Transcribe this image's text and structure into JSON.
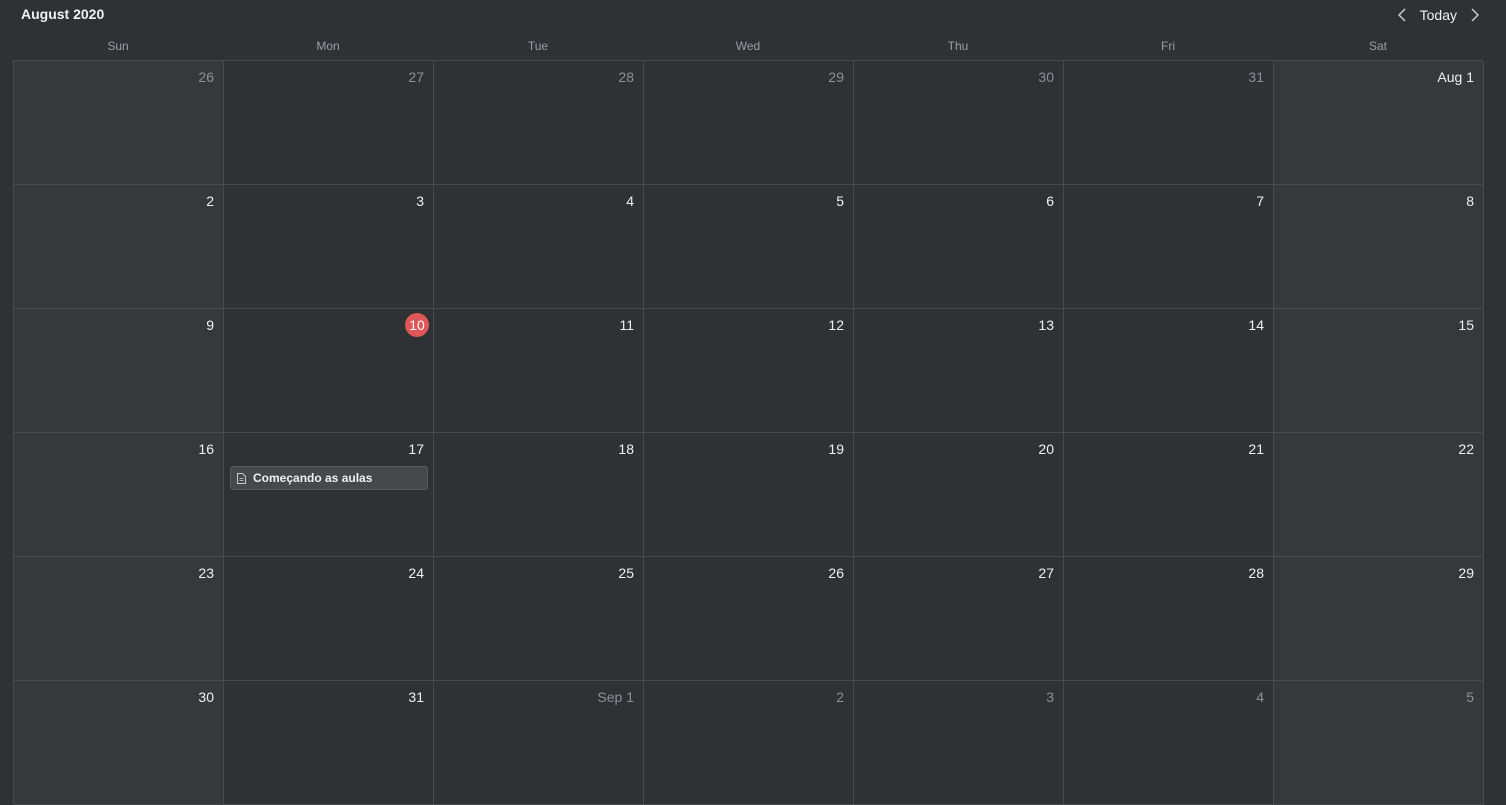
{
  "header": {
    "title": "August 2020",
    "today_label": "Today",
    "prev_icon": "chevron-left-icon",
    "next_icon": "chevron-right-icon"
  },
  "weekdays": [
    "Sun",
    "Mon",
    "Tue",
    "Wed",
    "Thu",
    "Fri",
    "Sat"
  ],
  "colors": {
    "background": "#2e3235",
    "weekend_background": "#36393c",
    "grid_line": "#474b4e",
    "today_badge": "#e05656",
    "event_background": "#45494c"
  },
  "weeks": [
    [
      {
        "label": "26",
        "current_month": false
      },
      {
        "label": "27",
        "current_month": false
      },
      {
        "label": "28",
        "current_month": false
      },
      {
        "label": "29",
        "current_month": false
      },
      {
        "label": "30",
        "current_month": false
      },
      {
        "label": "31",
        "current_month": false
      },
      {
        "label": "Aug 1",
        "current_month": true
      }
    ],
    [
      {
        "label": "2",
        "current_month": true
      },
      {
        "label": "3",
        "current_month": true
      },
      {
        "label": "4",
        "current_month": true
      },
      {
        "label": "5",
        "current_month": true
      },
      {
        "label": "6",
        "current_month": true
      },
      {
        "label": "7",
        "current_month": true
      },
      {
        "label": "8",
        "current_month": true
      }
    ],
    [
      {
        "label": "9",
        "current_month": true
      },
      {
        "label": "10",
        "current_month": true,
        "today": true
      },
      {
        "label": "11",
        "current_month": true
      },
      {
        "label": "12",
        "current_month": true
      },
      {
        "label": "13",
        "current_month": true
      },
      {
        "label": "14",
        "current_month": true
      },
      {
        "label": "15",
        "current_month": true
      }
    ],
    [
      {
        "label": "16",
        "current_month": true
      },
      {
        "label": "17",
        "current_month": true,
        "events": [
          {
            "title": "Começando as aulas",
            "icon": "document-icon"
          }
        ]
      },
      {
        "label": "18",
        "current_month": true
      },
      {
        "label": "19",
        "current_month": true
      },
      {
        "label": "20",
        "current_month": true
      },
      {
        "label": "21",
        "current_month": true
      },
      {
        "label": "22",
        "current_month": true
      }
    ],
    [
      {
        "label": "23",
        "current_month": true
      },
      {
        "label": "24",
        "current_month": true
      },
      {
        "label": "25",
        "current_month": true
      },
      {
        "label": "26",
        "current_month": true
      },
      {
        "label": "27",
        "current_month": true
      },
      {
        "label": "28",
        "current_month": true
      },
      {
        "label": "29",
        "current_month": true
      }
    ],
    [
      {
        "label": "30",
        "current_month": true
      },
      {
        "label": "31",
        "current_month": true
      },
      {
        "label": "Sep 1",
        "current_month": false
      },
      {
        "label": "2",
        "current_month": false
      },
      {
        "label": "3",
        "current_month": false
      },
      {
        "label": "4",
        "current_month": false
      },
      {
        "label": "5",
        "current_month": false
      }
    ]
  ]
}
